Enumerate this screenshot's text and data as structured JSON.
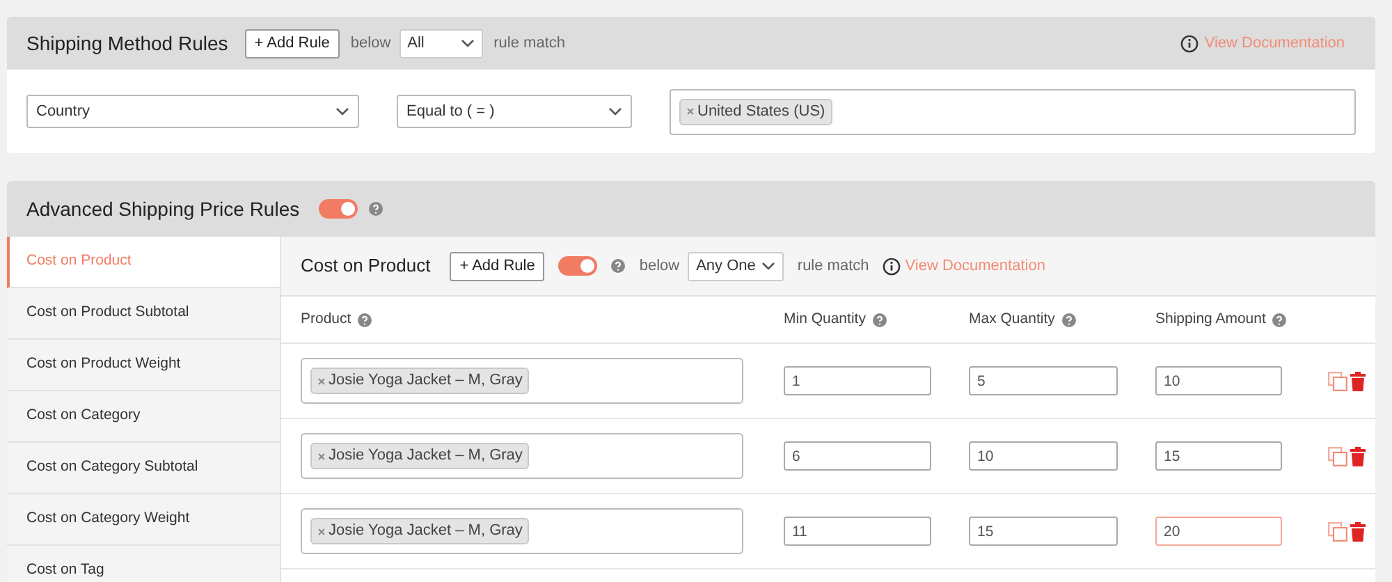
{
  "shipping_method_rules": {
    "title": "Shipping Method Rules",
    "add_rule": "+ Add Rule",
    "below": "below",
    "match_select": "All",
    "rule_match": "rule match",
    "documentation": "View Documentation",
    "condition": {
      "field": "Country",
      "operator": "Equal to ( = )",
      "tags": [
        "United States (US)"
      ]
    }
  },
  "advanced_rules": {
    "title": "Advanced Shipping Price Rules",
    "enabled": true,
    "sidebar": [
      {
        "label": "Cost on Product",
        "selected": true
      },
      {
        "label": "Cost on Product Subtotal",
        "selected": false
      },
      {
        "label": "Cost on Product Weight",
        "selected": false
      },
      {
        "label": "Cost on Category",
        "selected": false
      },
      {
        "label": "Cost on Category Subtotal",
        "selected": false
      },
      {
        "label": "Cost on Category Weight",
        "selected": false
      },
      {
        "label": "Cost on Tag",
        "selected": false
      }
    ],
    "panel": {
      "title": "Cost on Product",
      "add_rule": "+ Add Rule",
      "enabled": true,
      "below": "below",
      "match_select": "Any One",
      "rule_match": "rule match",
      "documentation": "View Documentation",
      "columns": [
        "Product",
        "Min Quantity",
        "Max Quantity",
        "Shipping Amount"
      ],
      "rows": [
        {
          "product": "Josie Yoga Jacket – M, Gray",
          "min": "1",
          "max": "5",
          "amount": "10",
          "amount_focused": false
        },
        {
          "product": "Josie Yoga Jacket – M, Gray",
          "min": "6",
          "max": "10",
          "amount": "15",
          "amount_focused": false
        },
        {
          "product": "Josie Yoga Jacket – M, Gray",
          "min": "11",
          "max": "15",
          "amount": "20",
          "amount_focused": true
        }
      ]
    }
  }
}
